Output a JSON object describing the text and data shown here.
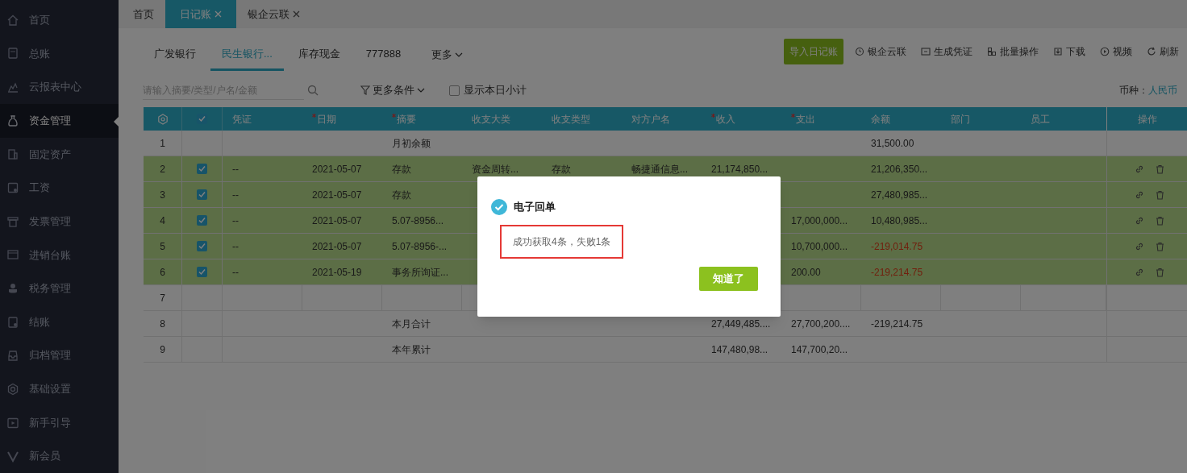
{
  "sidebar": {
    "items": [
      {
        "label": "首页",
        "selected": false
      },
      {
        "label": "总账",
        "selected": false
      },
      {
        "label": "云报表中心",
        "selected": false
      },
      {
        "label": "资金管理",
        "selected": true
      },
      {
        "label": "固定资产",
        "selected": false
      },
      {
        "label": "工资",
        "selected": false
      },
      {
        "label": "发票管理",
        "selected": false
      },
      {
        "label": "进销台账",
        "selected": false
      },
      {
        "label": "税务管理",
        "selected": false
      },
      {
        "label": "结账",
        "selected": false
      },
      {
        "label": "归档管理",
        "selected": false
      },
      {
        "label": "基础设置",
        "selected": false
      },
      {
        "label": "新手引导",
        "selected": false
      },
      {
        "label": "新会员",
        "selected": false
      }
    ]
  },
  "page_tabs": [
    {
      "label": "首页",
      "selected": false,
      "closable": false
    },
    {
      "label": "日记账",
      "selected": true,
      "closable": true
    },
    {
      "label": "银企云联",
      "selected": false,
      "closable": true
    }
  ],
  "account_tabs": [
    {
      "label": "广发银行",
      "selected": false
    },
    {
      "label": "民生银行...",
      "selected": true
    },
    {
      "label": "库存现金",
      "selected": false
    },
    {
      "label": "777888",
      "selected": false
    }
  ],
  "more_accounts": "更多",
  "toolbar": {
    "primary": "导入日记账",
    "actions": [
      "银企云联",
      "生成凭证",
      "批量操作",
      "下载",
      "视频",
      "刷新"
    ]
  },
  "search": {
    "placeholder": "请输入摘要/类型/户名/金额"
  },
  "filter": "更多条件",
  "daily_subtotal": {
    "label": "显示本日小计",
    "checked": false
  },
  "currency": {
    "label": "币种：",
    "value": "人民币"
  },
  "table": {
    "all_checked": true,
    "columns": [
      {
        "label": "凭证",
        "required": false
      },
      {
        "label": "日期",
        "required": true
      },
      {
        "label": "摘要",
        "required": true
      },
      {
        "label": "收支大类",
        "required": false
      },
      {
        "label": "收支类型",
        "required": false
      },
      {
        "label": "对方户名",
        "required": false
      },
      {
        "label": "收入",
        "required": true
      },
      {
        "label": "支出",
        "required": true
      },
      {
        "label": "余额",
        "required": false
      },
      {
        "label": "部门",
        "required": false
      },
      {
        "label": "员工",
        "required": false
      }
    ],
    "actions_label": "操作",
    "rows": [
      {
        "no": "1",
        "kind": "summary",
        "selected": false,
        "balance_alert": false,
        "cells": [
          null,
          null,
          "月初余额",
          null,
          null,
          null,
          null,
          null,
          "31,500.00",
          null,
          null
        ]
      },
      {
        "no": "2",
        "kind": "entry",
        "selected": true,
        "balance_alert": false,
        "cells": [
          "--",
          "2021-05-07",
          "存款",
          "资金周转...",
          "存款",
          "畅捷通信息...",
          "21,174,850...",
          null,
          "21,206,350...",
          null,
          null
        ]
      },
      {
        "no": "3",
        "kind": "entry",
        "selected": true,
        "balance_alert": false,
        "cells": [
          "--",
          "2021-05-07",
          "存款",
          null,
          null,
          null,
          null,
          null,
          "27,480,985...",
          null,
          null
        ]
      },
      {
        "no": "4",
        "kind": "entry",
        "selected": true,
        "balance_alert": false,
        "cells": [
          "--",
          "2021-05-07",
          "5.07-8956...",
          null,
          null,
          null,
          null,
          "17,000,000...",
          "10,480,985...",
          null,
          null
        ]
      },
      {
        "no": "5",
        "kind": "entry",
        "selected": true,
        "balance_alert": true,
        "cells": [
          "--",
          "2021-05-07",
          "5.07-8956-...",
          null,
          null,
          null,
          null,
          "10,700,000...",
          "-219,014.75",
          null,
          null
        ]
      },
      {
        "no": "6",
        "kind": "entry",
        "selected": true,
        "balance_alert": true,
        "cells": [
          "--",
          "2021-05-19",
          "事务所询证...",
          null,
          null,
          null,
          null,
          "200.00",
          "-219,214.75",
          null,
          null
        ]
      },
      {
        "no": "7",
        "kind": "blank",
        "selected": false
      },
      {
        "no": "8",
        "kind": "summary",
        "selected": false,
        "balance_alert": false,
        "cells": [
          null,
          null,
          "本月合计",
          null,
          null,
          null,
          "27,449,485....",
          "27,700,200....",
          "-219,214.75",
          null,
          null
        ]
      },
      {
        "no": "9",
        "kind": "summary",
        "selected": false,
        "cells": [
          null,
          null,
          "本年累计",
          null,
          null,
          null,
          "147,480,98...",
          "147,700,20...",
          null,
          null,
          null
        ]
      }
    ]
  },
  "dialog": {
    "title": "电子回单",
    "message": "成功获取4条，失败1条",
    "highlighted": true,
    "button": "知道了"
  }
}
